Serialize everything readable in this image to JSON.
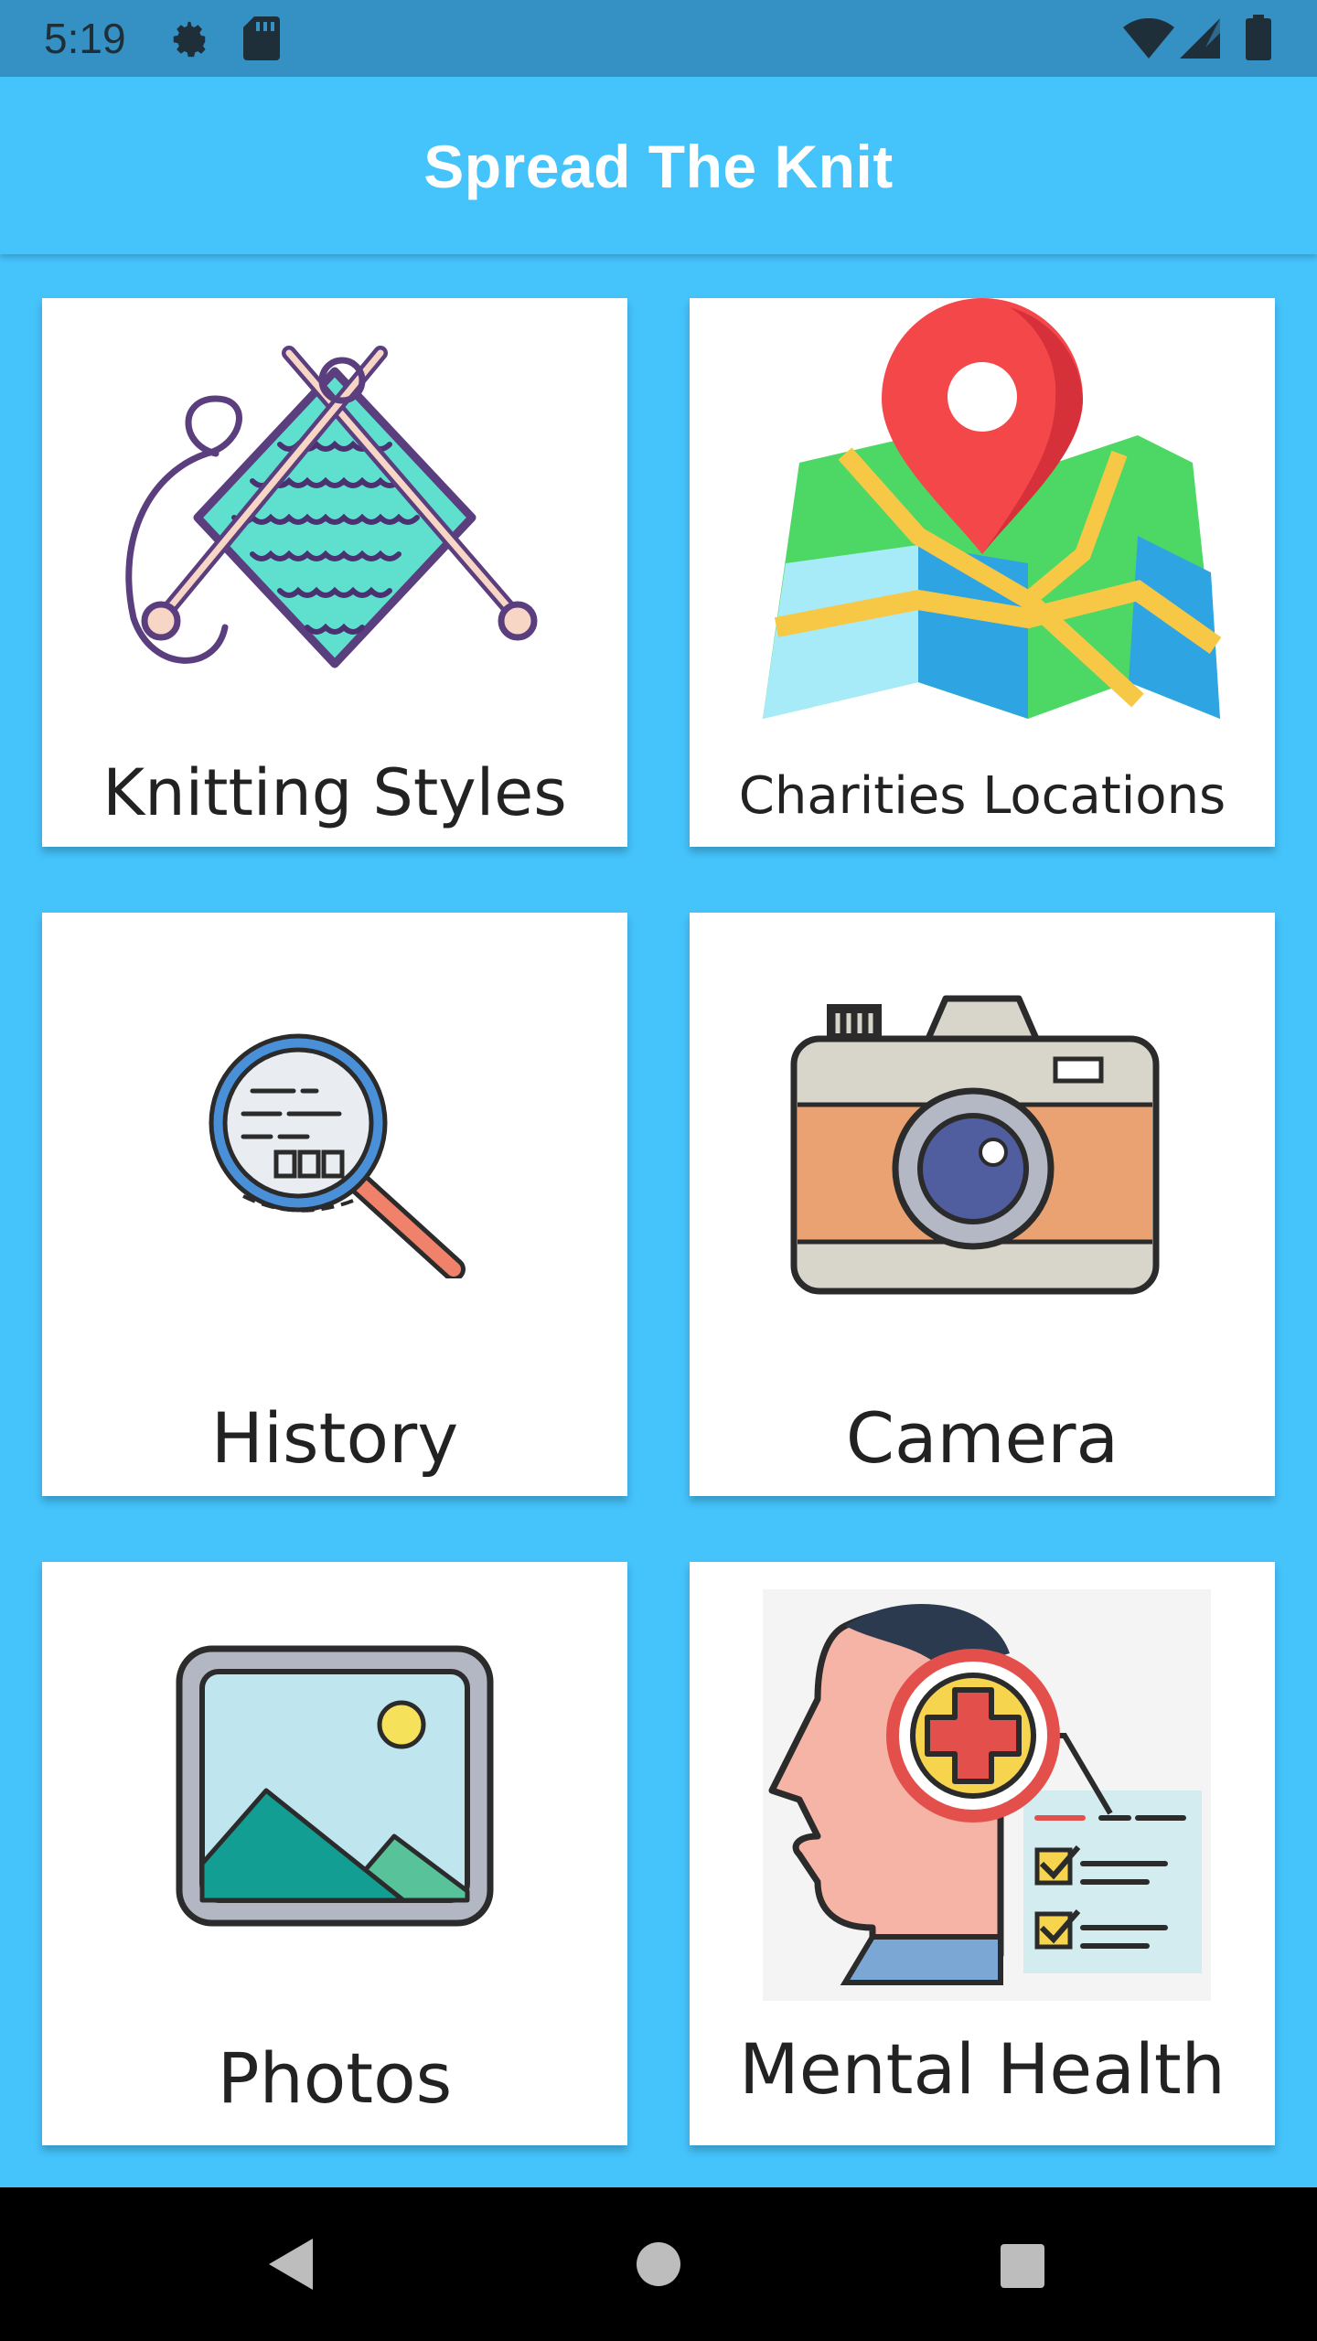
{
  "status_bar": {
    "time": "5:19",
    "left_icons": [
      "gear-icon",
      "sd-card-icon"
    ],
    "right_icons": [
      "wifi-icon",
      "signal-icon",
      "battery-icon"
    ]
  },
  "app_bar": {
    "title": "Spread The Knit",
    "background": "#45C3FB"
  },
  "menu": {
    "tiles": [
      {
        "label": "Knitting Styles",
        "icon": "knitting-icon"
      },
      {
        "label": "Charities Locations",
        "icon": "map-pin-icon"
      },
      {
        "label": "History",
        "icon": "magnifier-icon"
      },
      {
        "label": "Camera",
        "icon": "camera-icon"
      },
      {
        "label": "Photos",
        "icon": "photo-icon"
      },
      {
        "label": "Mental Health",
        "icon": "mental-health-icon"
      }
    ]
  },
  "nav_bar": {
    "buttons": [
      "back-icon",
      "home-icon",
      "recents-icon"
    ]
  }
}
